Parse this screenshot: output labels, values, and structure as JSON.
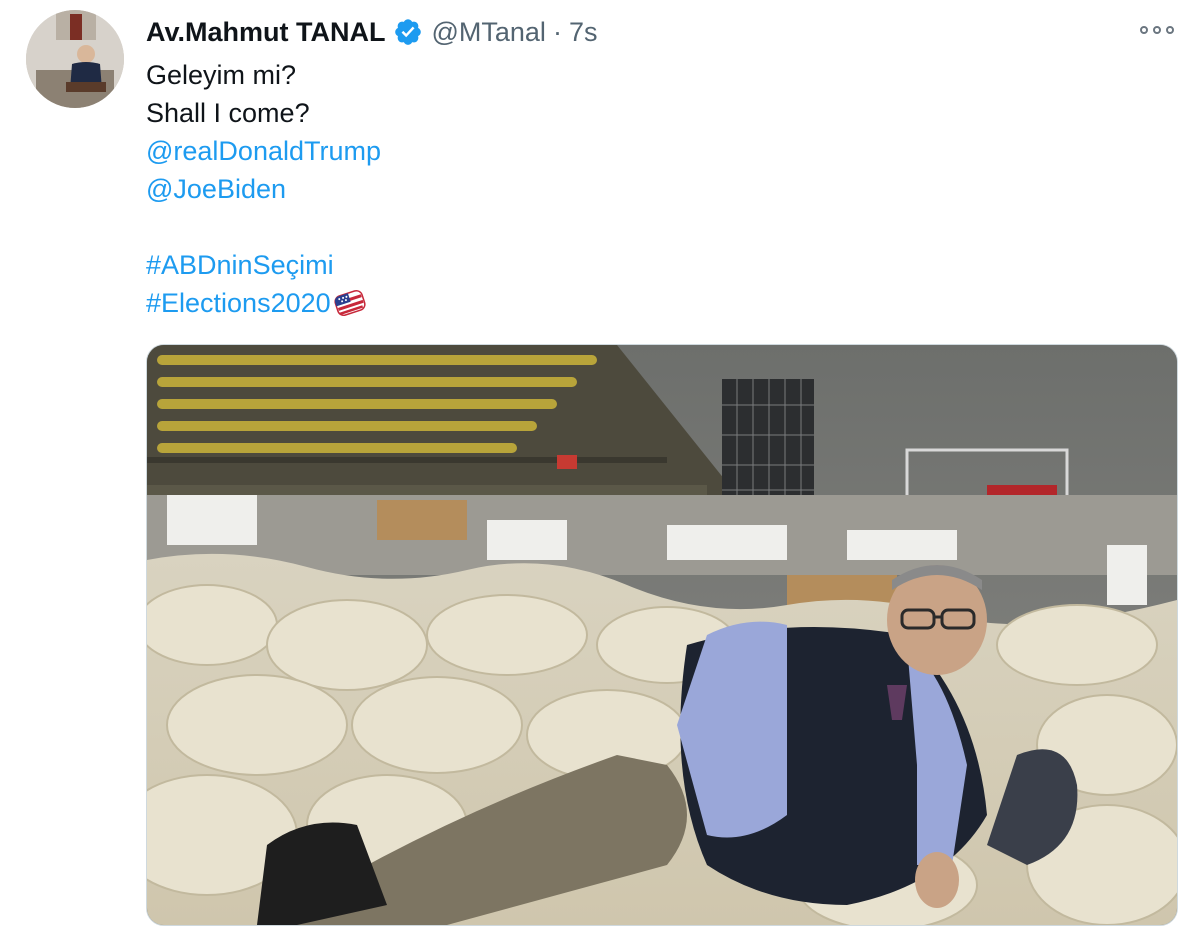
{
  "tweet": {
    "author_name": "Av.Mahmut TANAL",
    "author_handle": "@MTanal",
    "separator": "·",
    "time": "7s",
    "verified": true,
    "lines": [
      "Geleyim mi?",
      "Shall I come?"
    ],
    "mentions": [
      "@realDonaldTrump",
      "@JoeBiden"
    ],
    "hashtags": [
      "#ABDninSeçimi",
      "#Elections2020"
    ]
  },
  "colors": {
    "link": "#1d9bf0",
    "text": "#0f1419",
    "secondary": "#536471",
    "verified": "#1d9bf0"
  },
  "icons": {
    "verified": "verified-badge-icon",
    "more": "more-options-icon",
    "hashflag": "us-elections-hashflag-icon"
  }
}
